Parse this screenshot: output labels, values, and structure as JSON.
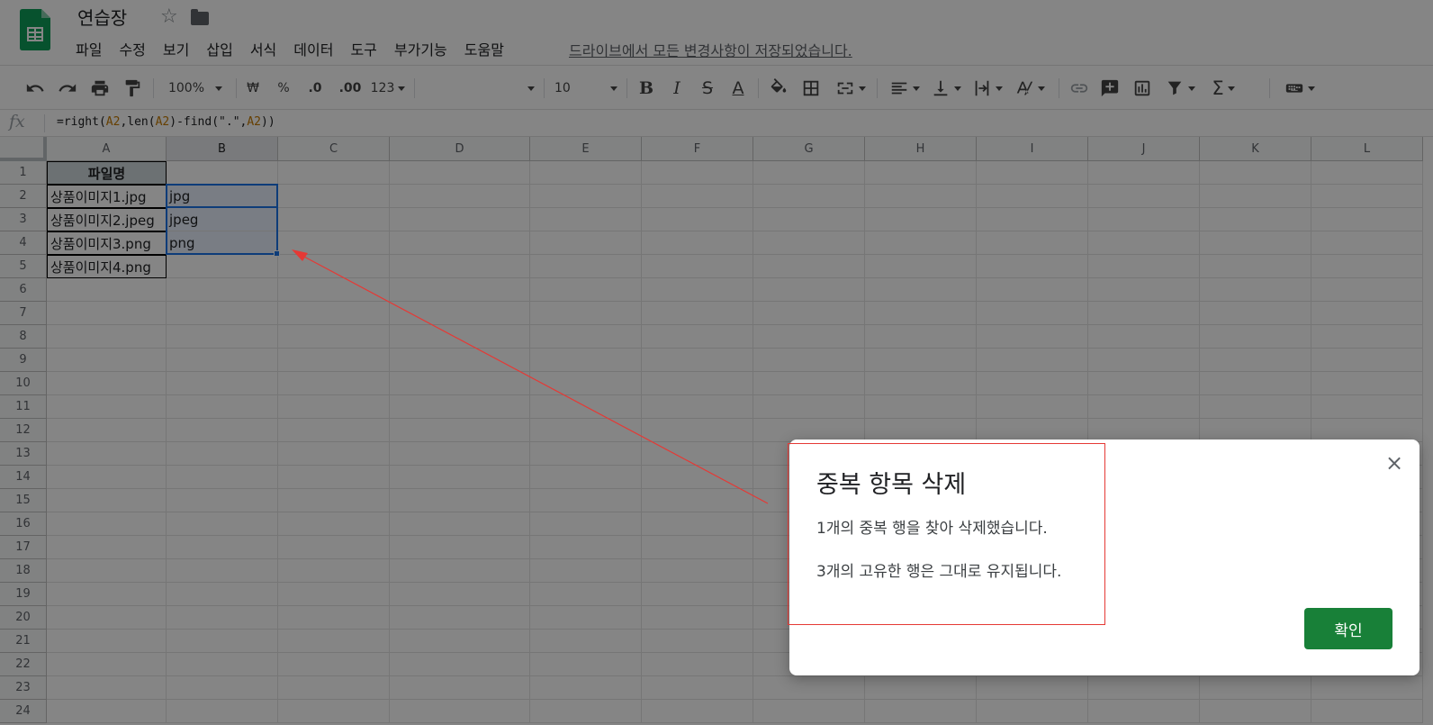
{
  "doc": {
    "title": "연습장",
    "save_status": "드라이브에서 모든 변경사항이 저장되었습니다."
  },
  "menu": [
    "파일",
    "수정",
    "보기",
    "삽입",
    "서식",
    "데이터",
    "도구",
    "부가기능",
    "도움말"
  ],
  "toolbar": {
    "zoom": "100%",
    "currency": "₩",
    "percent": "%",
    "decimal_decrease": ".0",
    "decimal_increase": ".00",
    "number_format": "123",
    "font_size": "10"
  },
  "formula_bar": {
    "fx_label": "fx",
    "formula_parts": [
      "=right(",
      "A2",
      ",len(",
      "A2",
      ")-find(\".\",",
      "A2",
      "))"
    ]
  },
  "sheet": {
    "columns": [
      "A",
      "B",
      "C",
      "D",
      "E",
      "F",
      "G",
      "H",
      "I",
      "J",
      "K",
      "L"
    ],
    "rows": [
      "1",
      "2",
      "3",
      "4",
      "5",
      "6",
      "7",
      "8",
      "9",
      "10",
      "11",
      "12",
      "13",
      "14",
      "15",
      "16",
      "17",
      "18",
      "19",
      "20",
      "21",
      "22",
      "23",
      "24"
    ],
    "cells": {
      "A1": "파일명",
      "A2": "상품이미지1.jpg",
      "A3": "상품이미지2.jpeg",
      "A4": "상품이미지3.png",
      "A5": "상품이미지4.png",
      "B2": "jpg",
      "B3": "jpeg",
      "B4": "png"
    }
  },
  "dialog": {
    "title": "중복 항목 삭제",
    "line1": "1개의 중복 행을 찾아 삭제했습니다.",
    "line2": "3개의 고유한 행은 그대로 유지됩니다.",
    "close_glyph": "×",
    "ok_label": "확인"
  },
  "colors": {
    "sheets_green": "#0f9d58",
    "ok_button": "#188038",
    "annotation_red": "#e53935",
    "selection_blue": "#1a73e8"
  }
}
